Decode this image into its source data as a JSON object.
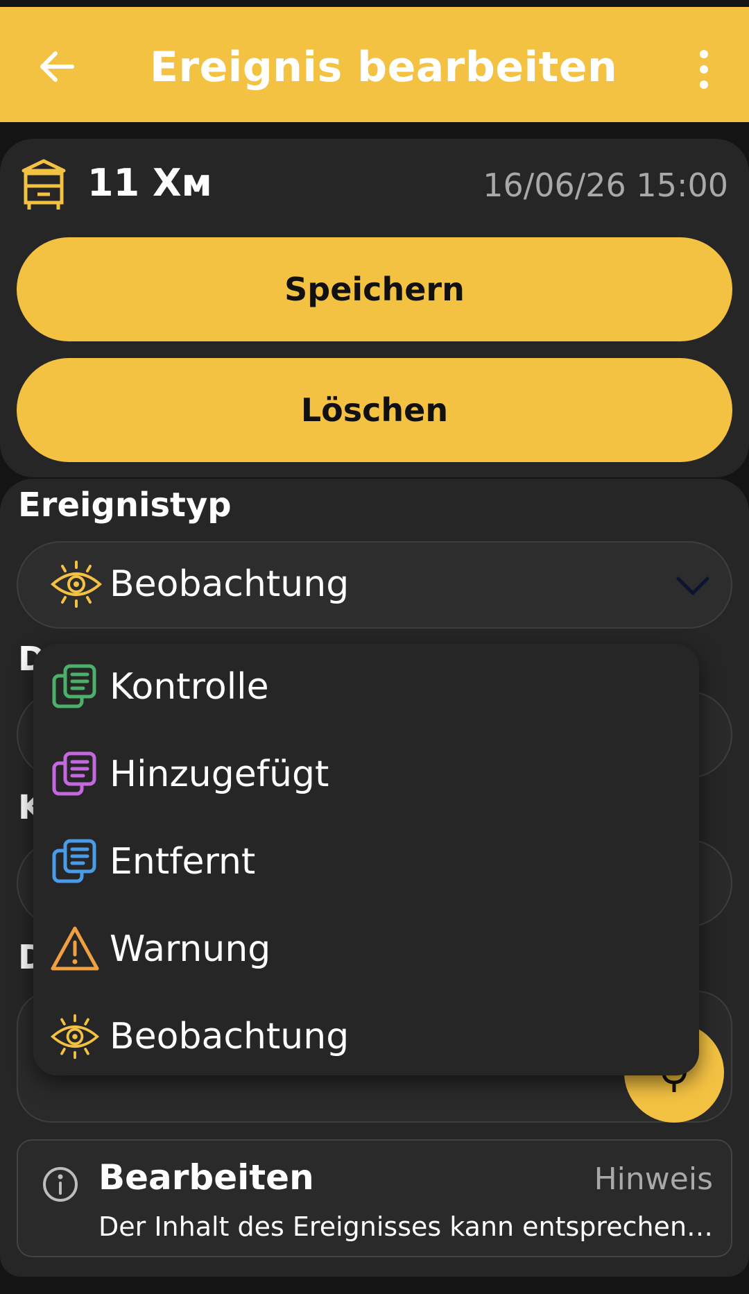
{
  "appbar": {
    "title": "Ereignis bearbeiten",
    "back_icon": "arrow-left-icon",
    "more_icon": "more-vertical-icon"
  },
  "hive": {
    "icon": "beehive-icon",
    "name": "11 Хм",
    "datetime": "16/06/26 15:00"
  },
  "actions": {
    "save_label": "Speichern",
    "delete_label": "Löschen"
  },
  "event_type": {
    "label": "Ereignistyp",
    "selected": "Beobachtung",
    "selected_icon": "eye-icon"
  },
  "hidden_labels": [
    "D",
    "K",
    "D"
  ],
  "dropdown": {
    "options": [
      {
        "label": "Kontrolle",
        "icon": "frames-icon",
        "color": "#4CAF6A"
      },
      {
        "label": "Hinzugefügt",
        "icon": "frames-icon",
        "color": "#C468E0"
      },
      {
        "label": "Entfernt",
        "icon": "frames-icon",
        "color": "#4A9BE8"
      },
      {
        "label": "Warnung",
        "icon": "warning-icon",
        "color": "#F0A040"
      },
      {
        "label": "Beobachtung",
        "icon": "eye-icon",
        "color": "#F4C242"
      }
    ]
  },
  "hint": {
    "icon": "info-icon",
    "title": "Bearbeiten",
    "tag": "Hinweis",
    "body": "Der Inhalt des Ereignisses kann entsprechend bearbeitet werden"
  },
  "colors": {
    "accent": "#F4C242",
    "background": "#141414",
    "card": "#262626"
  }
}
